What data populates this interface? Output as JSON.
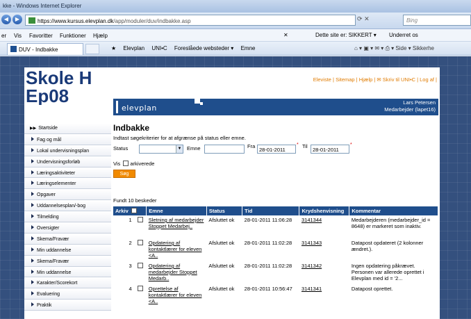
{
  "browser": {
    "window_title": "kke - Windows Internet Explorer",
    "url_host": "https://www.kursus.elevplan.dk",
    "url_path": "/app/moduler/duv/indbakke.asp",
    "search_placeholder": "Bing",
    "menu": [
      "er",
      "Vis",
      "Favoritter",
      "Funktioner",
      "Hjælp"
    ],
    "security_text": "Dette site er: SIKKERT ▾",
    "security_company": "Underret os",
    "tab_title": "DUV - Indbakke",
    "favorites": [
      "Elevplan",
      "UNI•C",
      "Foreslåede websteder ▾",
      "Emne"
    ],
    "toolbar_text": "Side ▾  Sikkerhe"
  },
  "site": {
    "school_line1": "Skole H",
    "school_line2": "Ep08",
    "top_links": "Eleviste | Sitemap | Hjælp | ✉ Skriv til UNI•C | Log af |",
    "logo": "elevplan",
    "user_name": "Lars Petersen",
    "user_role": "Medarbejder (lapet16)"
  },
  "nav": [
    "Startside",
    "Fag og mål",
    "Lokal undervisningsplan",
    "Undervisningsforløb",
    "Læringsaktiviteter",
    "Læringselementer",
    "Opgaver",
    "Uddannelsesplan/-bog",
    "Tilmelding",
    "Oversigter",
    "Skema/Fravær",
    "Min uddannelse",
    "Skema/Fravær",
    "Min uddannelse",
    "Karakter/Scorekort",
    "Evaluering",
    "Praktik"
  ],
  "inbox": {
    "title": "Indbakke",
    "description": "Indtast søgekriterier for at afgrænse på status eller emne.",
    "status_label": "Status",
    "status_value": "",
    "emne_label": "Emne",
    "emne_value": "",
    "fra_label": "Fra",
    "fra_value": "28-01-2011",
    "til_label": "Til",
    "til_value": "28-01-2011",
    "required_mark": "*",
    "vis_label": "Vis",
    "archive_label": "arkiverede",
    "search_button": "Søg",
    "found_text": "Fundt 10 beskeder",
    "columns": [
      "Arkiv",
      "Emne",
      "Status",
      "Tid",
      "Krydshenvisning",
      "Kommentar"
    ],
    "rows": [
      {
        "n": "1",
        "emne": "Sletning af medarbejder Stoppet Medarbej..",
        "status": "Afsluttet ok",
        "tid": "28-01-2011 11:06:28",
        "ref": "3141344",
        "kommentar": "Medarbejderen (medarbejder_id = 8648) er markeret som inaktiv."
      },
      {
        "n": "2",
        "emne": "Opdatering af kontaktlærer for eleven <A..",
        "status": "Afsluttet ok",
        "tid": "28-01-2011 11:02:28",
        "ref": "3141343",
        "kommentar": "Datapost opdateret (2 kolonner ændret.)."
      },
      {
        "n": "3",
        "emne": "Opdatering af medarbejder Stoppet Medarb..",
        "status": "Afsluttet ok",
        "tid": "28-01-2011 11:02:28",
        "ref": "3141342",
        "kommentar": "Ingen opdatering påkrævet. Personen var allerede oprettet i Elevplan med id = '2..."
      },
      {
        "n": "4",
        "emne": "Oprettelse af kontaktlærer for eleven <A..",
        "status": "Afsluttet ok",
        "tid": "28-01-2011 10:56:47",
        "ref": "3141341",
        "kommentar": "Datapost oprettet."
      }
    ]
  }
}
